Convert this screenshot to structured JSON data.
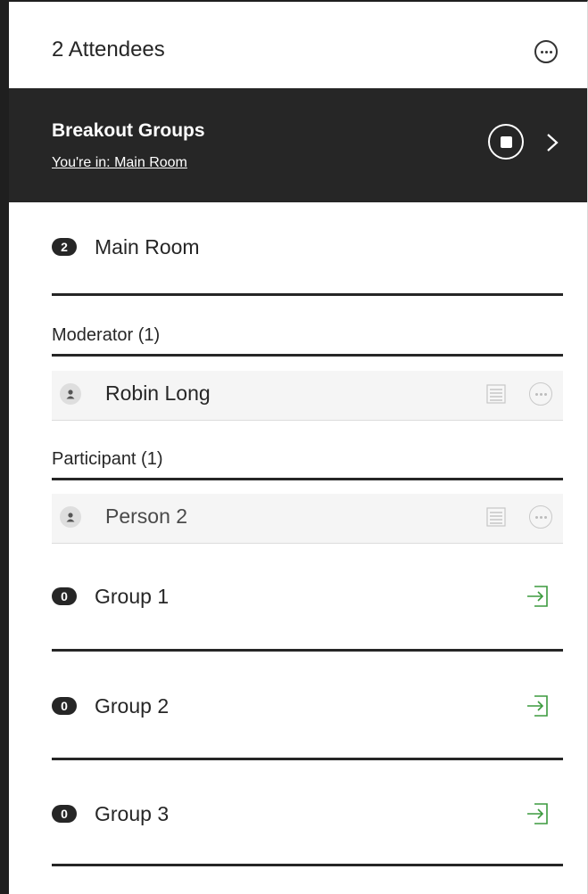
{
  "header": {
    "title": "2 Attendees",
    "more_icon": "ellipsis-circle-icon"
  },
  "banner": {
    "title": "Breakout Groups",
    "location_link": "You're in: Main Room",
    "stop_icon": "stop-circle-icon",
    "expand_icon": "chevron-right-icon"
  },
  "main_room": {
    "count": "2",
    "name": "Main Room"
  },
  "moderators": {
    "heading": "Moderator (1)",
    "people": [
      {
        "name": "Robin Long"
      }
    ]
  },
  "participants": {
    "heading": "Participant (1)",
    "people": [
      {
        "name": "Person 2"
      }
    ]
  },
  "groups": [
    {
      "count": "0",
      "name": "Group 1",
      "join_icon": "join-room-icon"
    },
    {
      "count": "0",
      "name": "Group 2",
      "join_icon": "join-room-icon"
    },
    {
      "count": "0",
      "name": "Group 3",
      "join_icon": "join-room-icon"
    }
  ],
  "colors": {
    "banner_bg": "#262626",
    "join_green": "#3c9a3e",
    "text": "#262626"
  }
}
